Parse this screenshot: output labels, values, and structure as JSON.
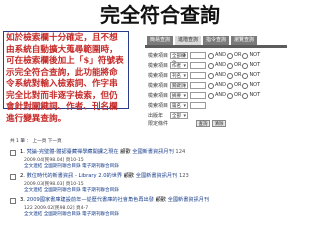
{
  "slide": {
    "title": "完全符合查詢",
    "callout": "如於檢索欄十分確定，且不想由系統自動擴大蒐尋範圍時，可在檢索欄後加上「$」符號表示完全符合查詢，此功能將命令系統對輸入檢索詞、作字串完全比對而非逐字檢索，但仍會針對關鍵詞、作者、刊名欄進行變異查詢。"
  },
  "search_form": {
    "tabs": [
      "簡易查詢",
      "進階查詢",
      "指令查詢",
      "瀏覽查詢"
    ],
    "active_tab_index": 1,
    "rows": [
      {
        "label": "檢索項目",
        "field": "全部欄位",
        "ops": [
          "AND",
          "OR",
          "NOT"
        ]
      },
      {
        "label": "檢索項目",
        "field": "作者",
        "ops": [
          "AND",
          "OR",
          "NOT"
        ]
      },
      {
        "label": "檢索項目",
        "field": "刊名",
        "ops": [
          "AND",
          "OR",
          "NOT"
        ]
      },
      {
        "label": "檢索項目",
        "field": "關鍵詞",
        "ops": [
          "AND",
          "OR",
          "NOT"
        ]
      },
      {
        "label": "檢索項目",
        "field": "摘要",
        "ops": [
          "AND",
          "OR",
          "NOT"
        ]
      },
      {
        "label": "檢索項目",
        "field": "篇名",
        "ops": []
      },
      {
        "label": "出版年",
        "field": "全部",
        "ops": []
      }
    ],
    "filter_label": "限定條件",
    "submit_label": "查詢",
    "clear_label": "清除"
  },
  "results": {
    "toolbar": "共 1 筆 ： 上一頁 下一頁",
    "items": [
      {
        "index": "1.",
        "title": "梵論-完璧體-體認臺藏禪學藏開課之現在",
        "author": "顧歡",
        "link_label": "全國新書資訊月刊",
        "count": "124",
        "meta": "2009.04[民98.04] 頁10-15",
        "actions": "全文連結 全國期刊聯合目錄 電子期刊聯合目錄"
      },
      {
        "index": "2.",
        "title": "數位時代的新書資訊 - Library 2.0的世界",
        "author": "顧歡",
        "link_label": "全國新書資訊月刊",
        "count": "123",
        "meta": "2009.03[民98.03] 頁10-15",
        "actions": "全文連結 全國期刊聯合目錄 電子期刊聯合目錄"
      },
      {
        "index": "3.",
        "title": "2009國家書庫建設前年—從歷代書庫的社會角色再出發",
        "author": "顧歡",
        "link_label": "全國新書資訊月刊",
        "count": "",
        "meta": "122 2009.02[民98.02] 頁4-7",
        "actions": "全文連結 全國期刊聯合目錄 電子期刊聯合目錄"
      }
    ]
  }
}
